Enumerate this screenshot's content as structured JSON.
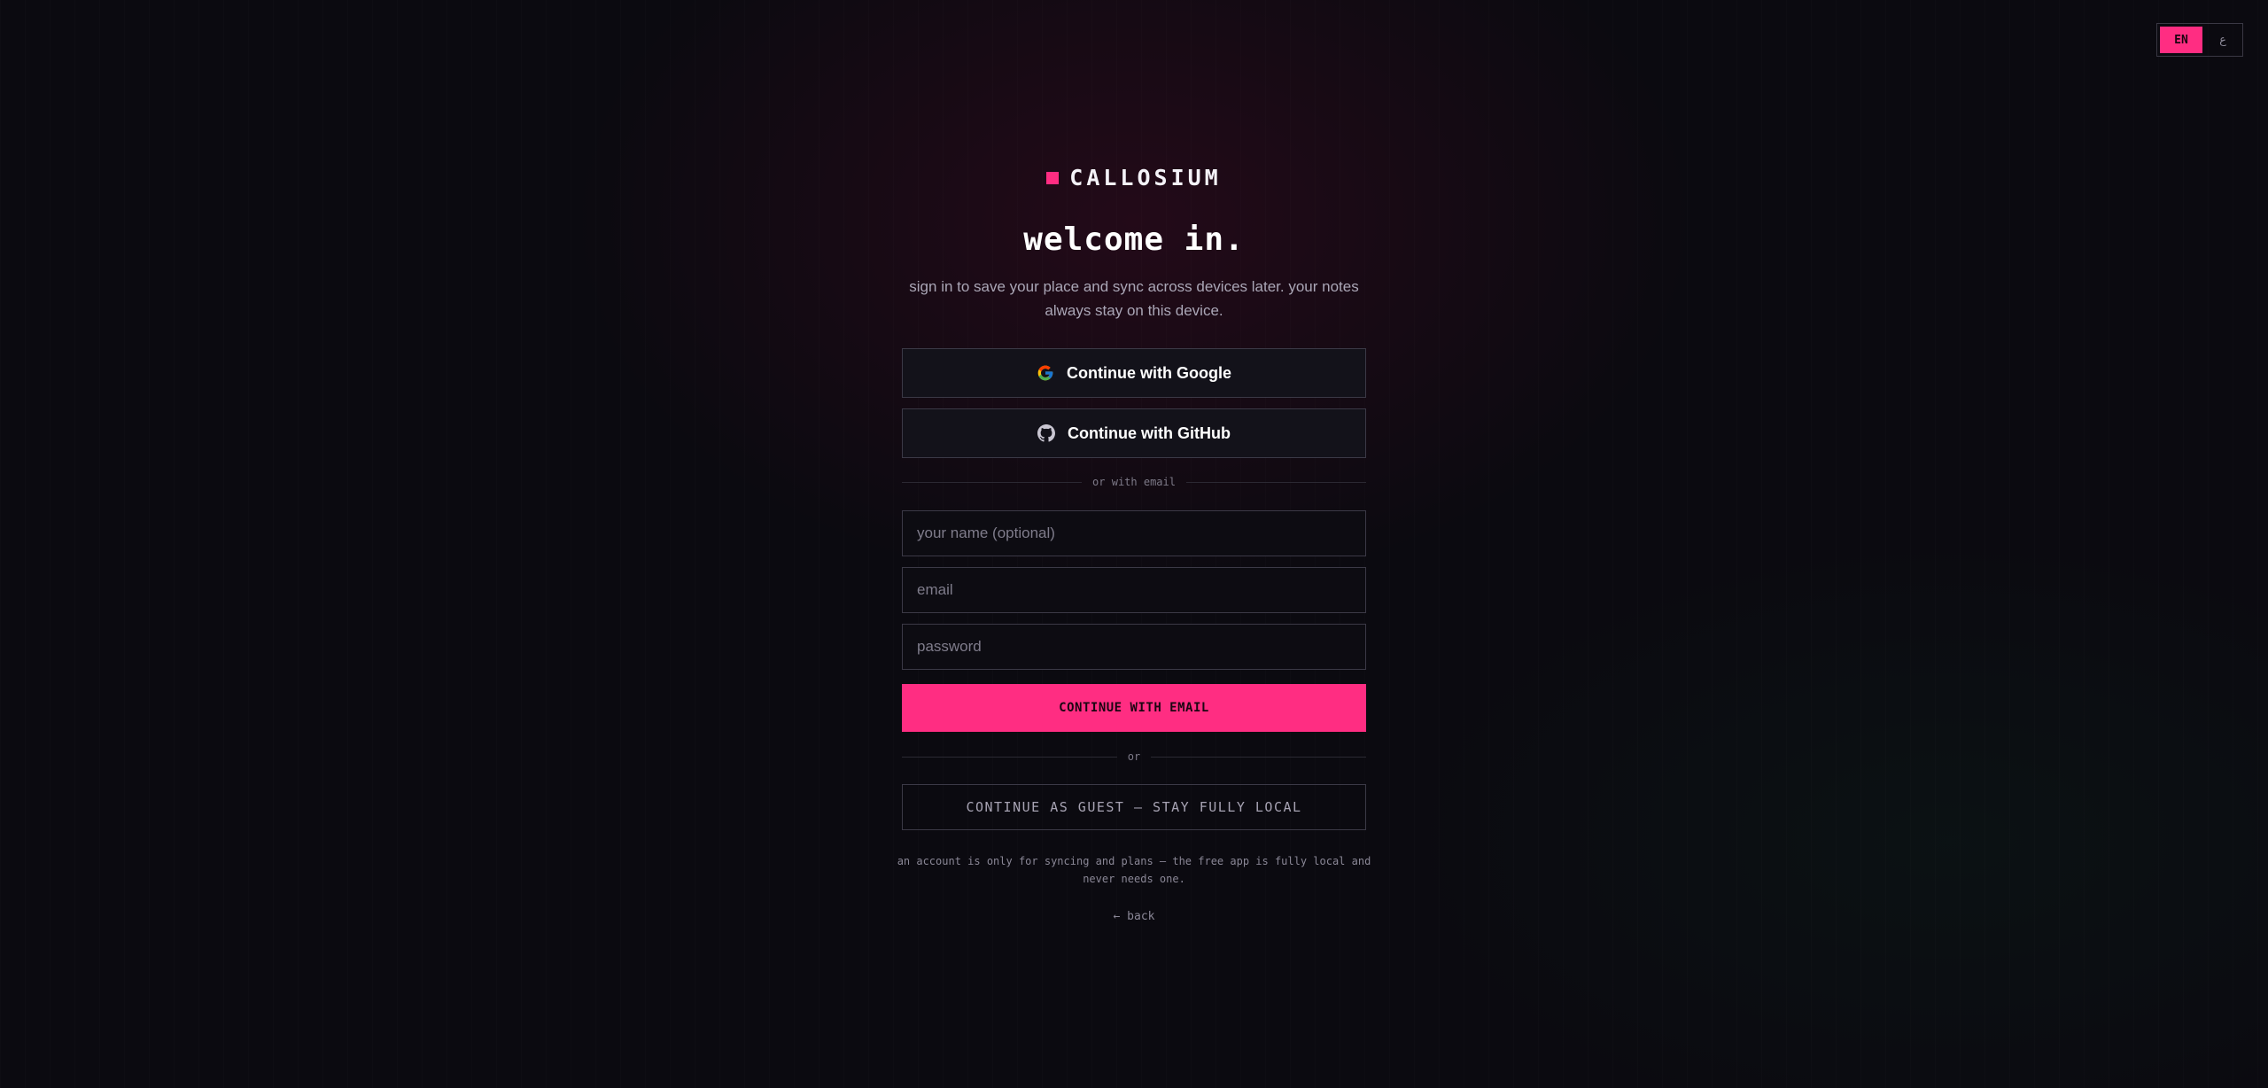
{
  "language_switch": {
    "active": "EN",
    "other": "ع"
  },
  "brand": {
    "name": "CALLOSIUM",
    "accent_color": "#ff2d82"
  },
  "auth": {
    "title": "welcome in.",
    "subtitle": "sign in to save your place and sync across devices later. your notes always stay on this device.",
    "google_label": "Continue with Google",
    "github_label": "Continue with GitHub",
    "email_divider": "or with email",
    "name_placeholder": "your name (optional)",
    "email_placeholder": "email",
    "password_placeholder": "password",
    "submit_label": "CONTINUE WITH EMAIL",
    "or_divider": "or",
    "guest_label": "CONTINUE AS GUEST — STAY FULLY LOCAL",
    "footnote": "an account is only for syncing and plans — the free app is fully local and never needs one.",
    "back_label": "← back"
  },
  "icons": [
    "google-icon",
    "github-icon"
  ]
}
